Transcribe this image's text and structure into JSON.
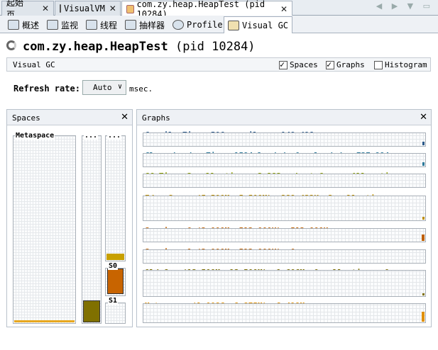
{
  "doc_tabs": [
    {
      "label": "起始页"
    },
    {
      "label": "VisualVM"
    },
    {
      "label": "com.zy.heap.HeapTest (pid 10284)"
    }
  ],
  "sub_tabs": [
    {
      "label": "概述"
    },
    {
      "label": "监视"
    },
    {
      "label": "线程"
    },
    {
      "label": "抽样器"
    },
    {
      "label": "Profiler"
    },
    {
      "label": "Visual GC"
    }
  ],
  "page": {
    "title": "com.zy.heap.HeapTest",
    "pid": "(pid 10284)"
  },
  "visual_gc_bar": {
    "label": "Visual GC",
    "options": [
      {
        "label": "Spaces",
        "checked": true
      },
      {
        "label": "Graphs",
        "checked": true
      },
      {
        "label": "Histogram",
        "checked": false
      }
    ]
  },
  "refresh": {
    "label": "Refresh rate:",
    "value": "Auto",
    "unit": "msec."
  },
  "spaces": {
    "title": "Spaces",
    "metaspace": {
      "label": "Metaspace",
      "fill": 0.01,
      "color": "#e8a820"
    },
    "old": {
      "label": "...",
      "fill": 0.12,
      "color": "#807000"
    },
    "eden": {
      "label": "...",
      "fill": 0.05,
      "color": "#c8a000"
    },
    "s0": {
      "label": "S0",
      "fill": 1.0,
      "color": "#c86400"
    },
    "s1": {
      "label": "S1",
      "fill": 0.0,
      "color": "#c86400"
    }
  },
  "graphs": {
    "title": "Graphs",
    "rows": [
      {
        "label": "Compile Time: 506 compiles - 149.418ms",
        "color": "#2c5a8a"
      },
      {
        "label": "Class Loader Time: 1594 loaded, 0 unloaded - 727.994ms",
        "color": "#2c7a9a"
      },
      {
        "label": "GC Time: 2 collections, 2.283ms Last Cause: Allocati...",
        "color": "#90a000"
      },
      {
        "label": "Eden Space (5.500M, 5.500M): 289.422K, 2 collections...",
        "color": "#c09000"
      },
      {
        "label": "Survivor 0 (2.000M, 512.000K): 512.000K",
        "color": "#c06000"
      },
      {
        "label": "Survivor 1 (2.000M, 512.000K): 0",
        "color": "#c06000"
      },
      {
        "label": "Old Gen (13.500M, 13.500M): 1.606M, 0 collections, 0s",
        "color": "#807000"
      },
      {
        "label": "Metaspace (1.008G, 8.875M): 8.419M",
        "color": "#e09000"
      }
    ]
  }
}
